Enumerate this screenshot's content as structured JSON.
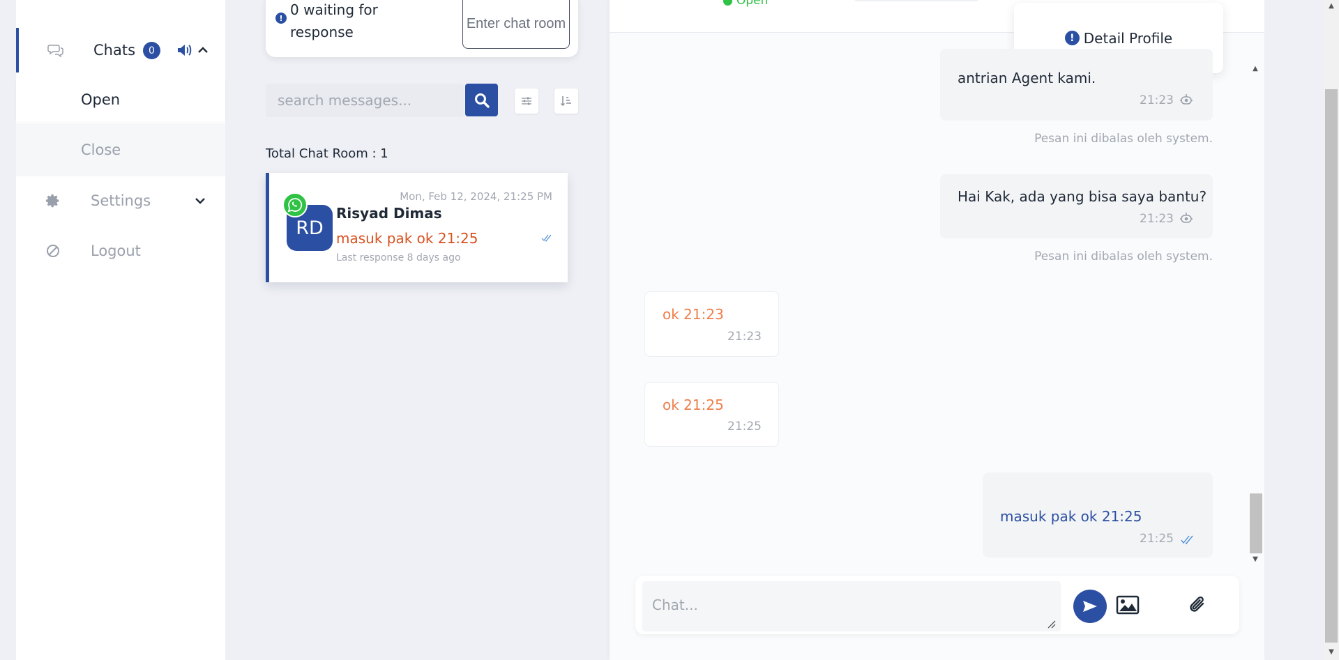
{
  "sidebar": {
    "chats_label": "Chats",
    "chats_count": "0",
    "open_label": "Open",
    "close_label": "Close",
    "settings_label": "Settings",
    "logout_label": "Logout"
  },
  "queue": {
    "waiting_text": "0 waiting for response",
    "enter_button": "Enter chat room"
  },
  "search": {
    "placeholder": "search messages..."
  },
  "rooms": {
    "total_text": "Total Chat Room : 1",
    "items": [
      {
        "date": "Mon, Feb 12, 2024, 21:25 PM",
        "initials": "RD",
        "name": "Risyad Dimas",
        "last_message": "masuk pak ok 21:25",
        "last_response": "Last response 8 days ago"
      }
    ]
  },
  "chat": {
    "header_status": "Open",
    "detail_profile": "Detail Profile",
    "messages": [
      {
        "direction": "out",
        "text": "antrian Agent kami.",
        "time": "21:23",
        "note": "Pesan ini dibalas oleh system."
      },
      {
        "direction": "out",
        "text": "Hai Kak, ada yang bisa saya bantu?",
        "time": "21:23",
        "note": "Pesan ini dibalas oleh system."
      },
      {
        "direction": "in",
        "text": "ok 21:23",
        "time": "21:23"
      },
      {
        "direction": "in",
        "text": "ok 21:25",
        "time": "21:25"
      },
      {
        "direction": "out",
        "text": "masuk pak ok 21:25",
        "time": "21:25"
      }
    ],
    "composer_placeholder": "Chat..."
  },
  "colors": {
    "brand": "#2b4fa2",
    "incoming_text": "#ef7e4a",
    "outgoing_agent_text": "#2b4fa2",
    "last_message": "#d8501f",
    "online": "#2fc244"
  },
  "icons": [
    "chat-bubble-icon",
    "speaker-icon",
    "chevron-up-icon",
    "gear-icon",
    "chevron-down-icon",
    "ban-icon",
    "info-icon",
    "search-icon",
    "sliders-icon",
    "sort-icon",
    "whatsapp-icon",
    "double-check-icon",
    "robot-icon",
    "send-icon",
    "image-icon",
    "paperclip-icon"
  ]
}
